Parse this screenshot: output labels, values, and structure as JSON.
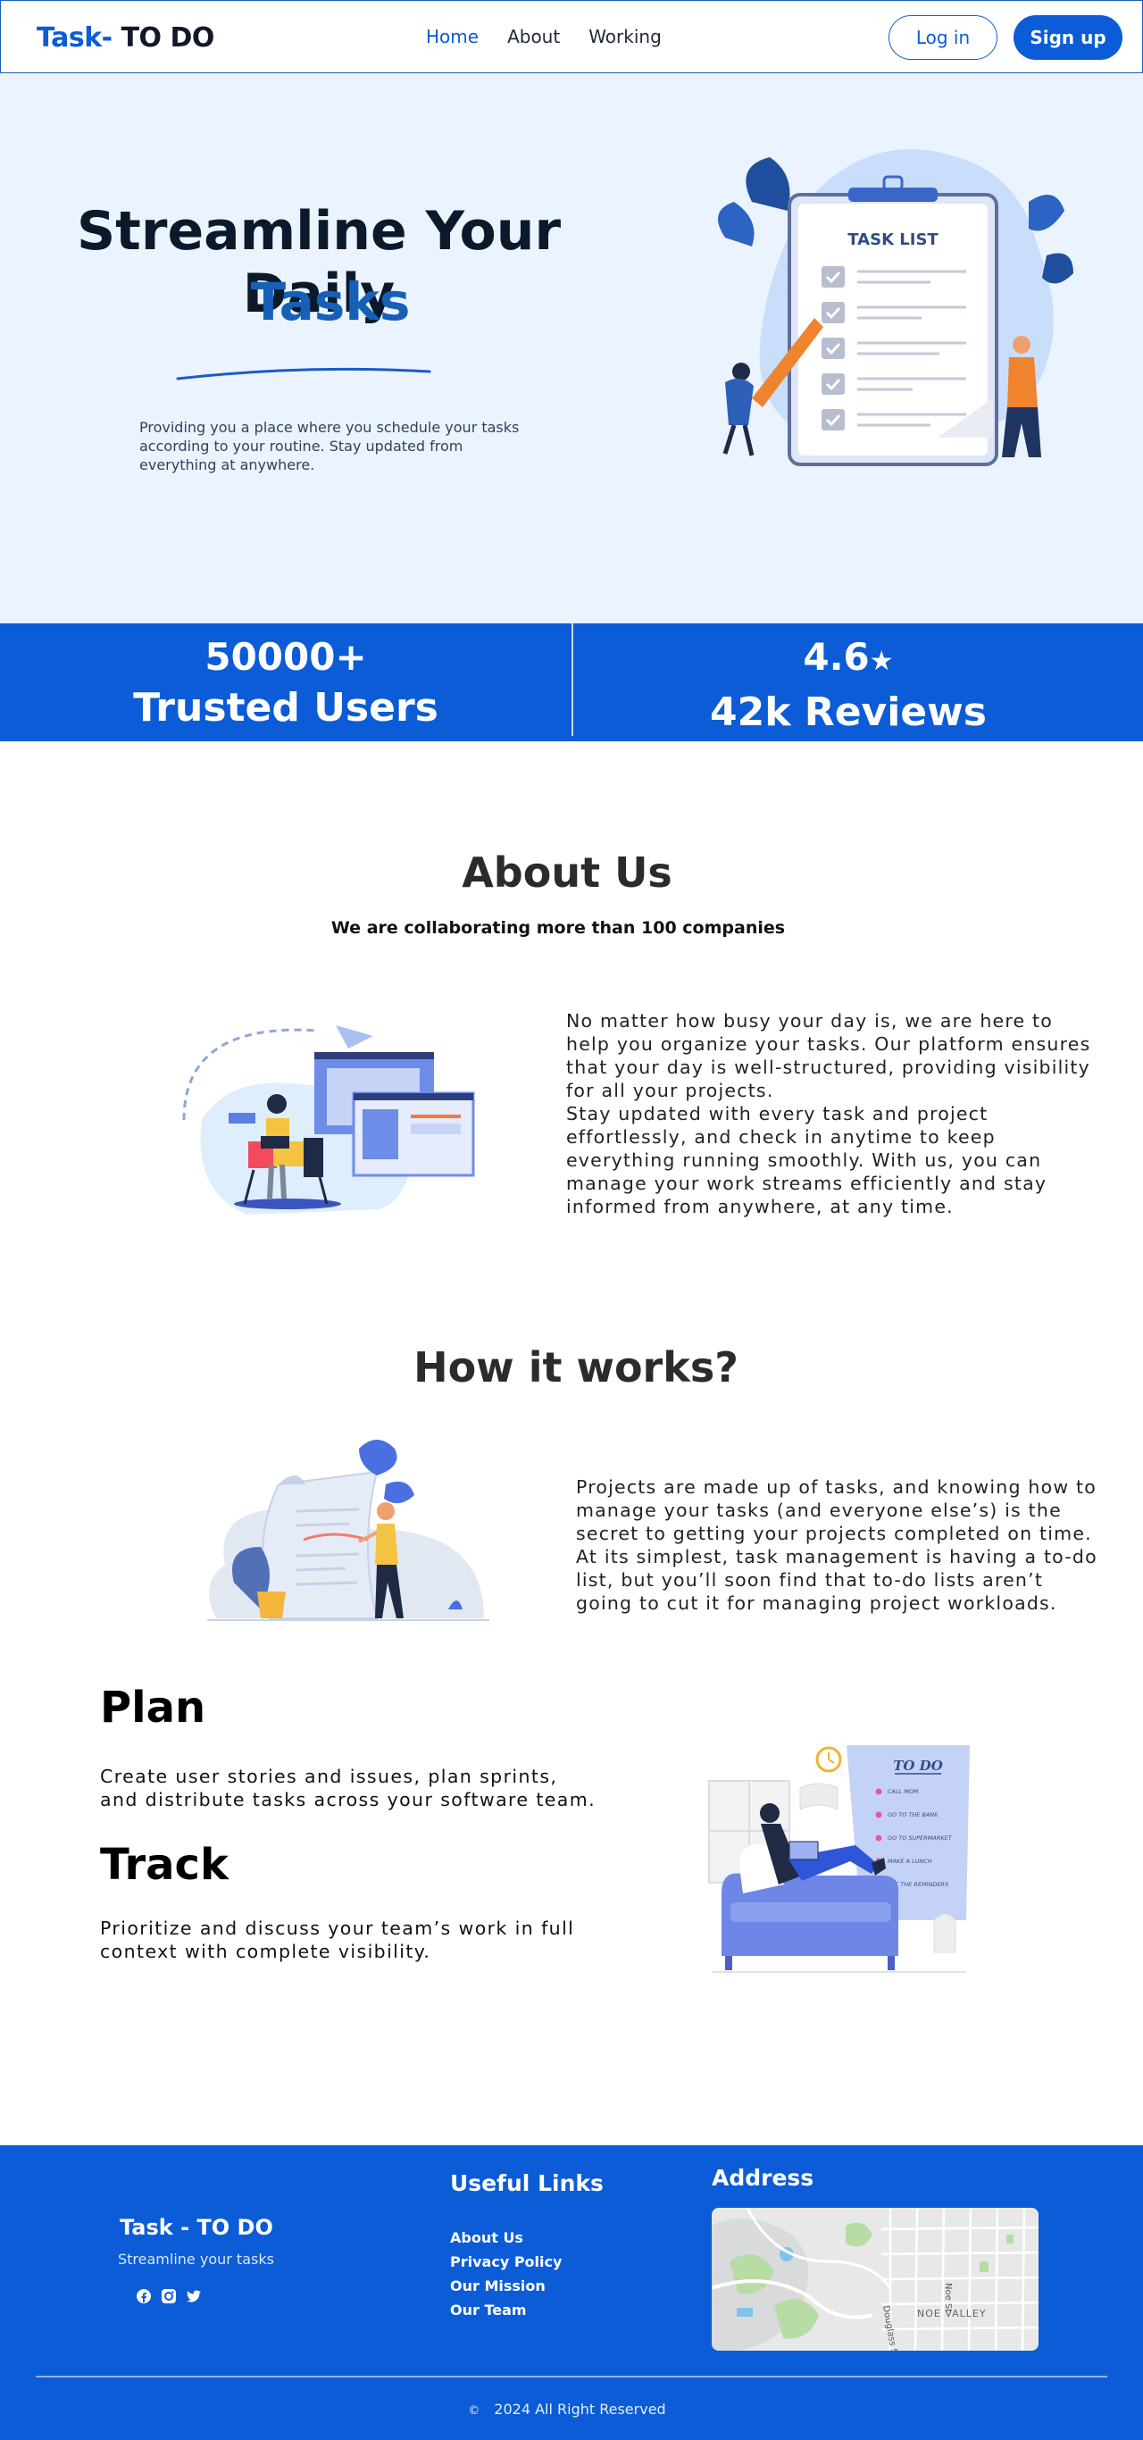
{
  "nav": {
    "logo_part1": "Task-",
    "logo_part2": "TO DO",
    "links": [
      "Home",
      "About",
      "Working"
    ],
    "login": "Log in",
    "signup": "Sign up"
  },
  "hero": {
    "title_line1": "Streamline Your Daily",
    "title_line2": "Tasks",
    "description": "Providing you a place where you schedule your tasks according to your routine. Stay updated from everything at anywhere.",
    "art_title": "TASK LIST"
  },
  "stats": [
    {
      "value": "50000+",
      "label": "Trusted Users"
    },
    {
      "value": "4.6",
      "star": "★",
      "label": "42k Reviews"
    }
  ],
  "about": {
    "title": "About Us",
    "subtitle": "We are collaborating more than 100 companies",
    "text": "No matter how busy your day is, we are here to help you organize your tasks. Our platform ensures that your day is well-structured, providing visibility for all your projects.\nStay updated with every task and project effortlessly, and check in anytime to keep everything running smoothly. With us, you can manage your work streams efficiently and stay informed from anywhere, at any time."
  },
  "how": {
    "title": "How it works?",
    "text": "Projects are made up of tasks, and knowing how to manage your tasks (and everyone else’s) is the secret to getting your projects completed on time. At its simplest, task management is having a to-do list, but you’ll soon find that to-do lists aren’t going to cut it for managing project workloads."
  },
  "plan": {
    "title": "Plan",
    "text": "Create user stories and issues, plan sprints, and distribute tasks across your software team."
  },
  "track": {
    "title": "Track",
    "text": "Prioritize and discuss your team’s work in full context with complete visibility."
  },
  "todo_art": {
    "heading": "TO DO",
    "items": [
      "CALL MOM",
      "GO TO THE BANK",
      "GO TO SUPERMARKET",
      "MAKE A LUNCH",
      "SET THE REMINDERS"
    ]
  },
  "footer": {
    "brand": "Task - TO DO",
    "tagline": "Streamline your  tasks",
    "links_title": "Useful Links",
    "links": [
      "About Us",
      "Privacy Policy",
      "Our Mission",
      "Our Team"
    ],
    "address_title": "Address",
    "map_labels": [
      "Noe St",
      "Douglass St",
      "NOE VALLEY"
    ],
    "copyright_symbol": "©",
    "copyright": "2024 All Right Reserved"
  },
  "colors": {
    "primary": "#0b5cd6",
    "hero_bg": "#ebf4fe",
    "title_blue": "#1660b8"
  }
}
